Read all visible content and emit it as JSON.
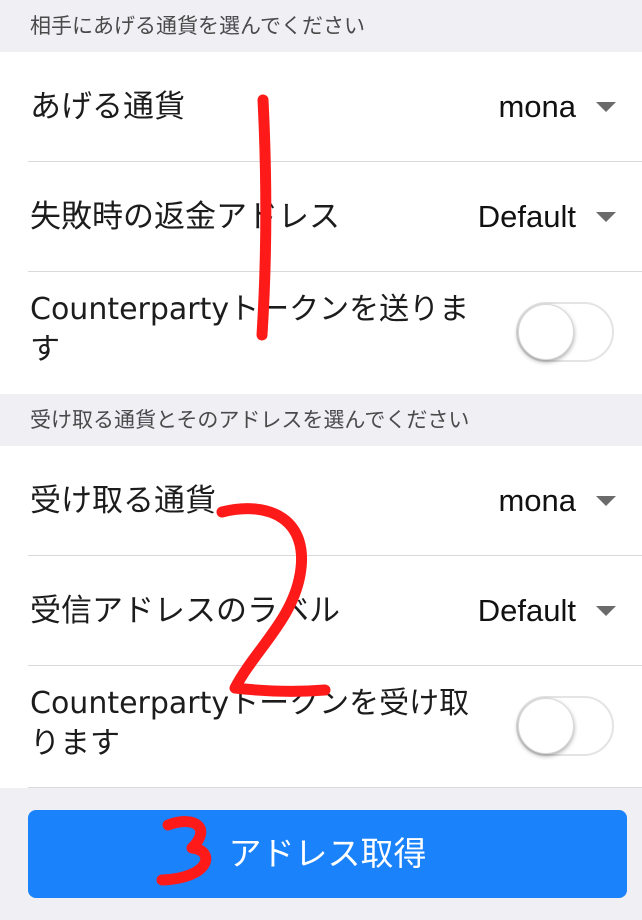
{
  "section1": {
    "header": "相手にあげる通貨を選んでください",
    "rows": [
      {
        "label": "あげる通貨",
        "value": "mona"
      },
      {
        "label": "失敗時の返金アドレス",
        "value": "Default"
      },
      {
        "label": "Counterpartyトークンを送ります",
        "toggle": "off"
      }
    ]
  },
  "section2": {
    "header": "受け取る通貨とそのアドレスを選んでください",
    "rows": [
      {
        "label": "受け取る通貨",
        "value": "mona"
      },
      {
        "label": "受信アドレスのラベル",
        "value": "Default"
      },
      {
        "label": "Counterpartyトークンを受け取ります",
        "toggle": "off"
      }
    ]
  },
  "button": {
    "label": "アドレス取得"
  },
  "annotations": {
    "mark1": "1",
    "mark2": "2",
    "mark3": "3",
    "color": "#ff1a1a"
  },
  "colors": {
    "accent": "#1a82fb",
    "background": "#efeff4"
  }
}
